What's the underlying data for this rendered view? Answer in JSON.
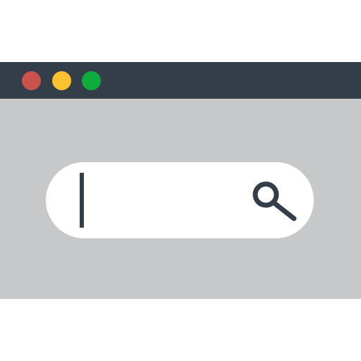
{
  "window": {
    "titlebar_color": "#333e48",
    "body_color": "#c7c8ca",
    "controls": [
      {
        "name": "close-button",
        "color": "#c9524f"
      },
      {
        "name": "minimize-button",
        "color": "#fcc12f"
      },
      {
        "name": "maximize-button",
        "color": "#0dac3d"
      }
    ]
  },
  "search": {
    "value": "",
    "placeholder": "",
    "icon": "search-icon",
    "icon_color": "#333e48"
  }
}
